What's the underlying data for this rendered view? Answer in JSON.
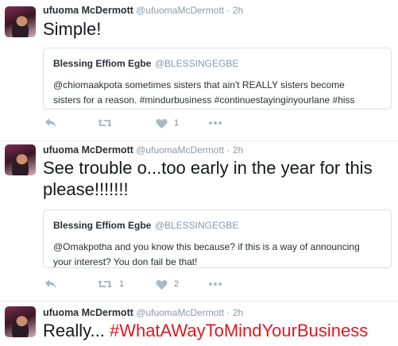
{
  "tweets": [
    {
      "name": "ufuoma McDermott",
      "handle": "@ufuomaMcDermott",
      "time": "2h",
      "text": "Simple!",
      "quote": {
        "name": "Blessing Effiom Egbe",
        "handle": "@BLESSINGEGBE",
        "text_line1": "@chiomaakpota sometimes sisters that ain't REALLY sisters become",
        "text_line2": "sisters for a reason. #mindurbusiness #continuestayinginyourlane #hiss"
      },
      "retweets": "",
      "likes": "1"
    },
    {
      "name": "ufuoma McDermott",
      "handle": "@ufuomaMcDermott",
      "time": "2h",
      "text_line1": "See trouble o...too early in the year for this",
      "text_line2": "please!!!!!!!",
      "quote": {
        "name": "Blessing Effiom Egbe",
        "handle": "@BLESSINGEGBE",
        "text_line1": "@Omakpotha and you know this because? if this is a way of announcing",
        "text_line2": "your interest? You don fail be that!"
      },
      "retweets": "1",
      "likes": "2"
    },
    {
      "name": "ufuoma McDermott",
      "handle": "@ufuomaMcDermott",
      "time": "2h",
      "text_plain": "Really... ",
      "text_hashtag": "#WhatAWayToMindYourBusiness"
    }
  ],
  "separator": "·",
  "colors": {
    "hashtag": "#e0181f",
    "muted": "#8899a6",
    "icon": "#aab8c2"
  },
  "icons": [
    "reply-icon",
    "retweet-icon",
    "heart-icon",
    "more-icon"
  ]
}
